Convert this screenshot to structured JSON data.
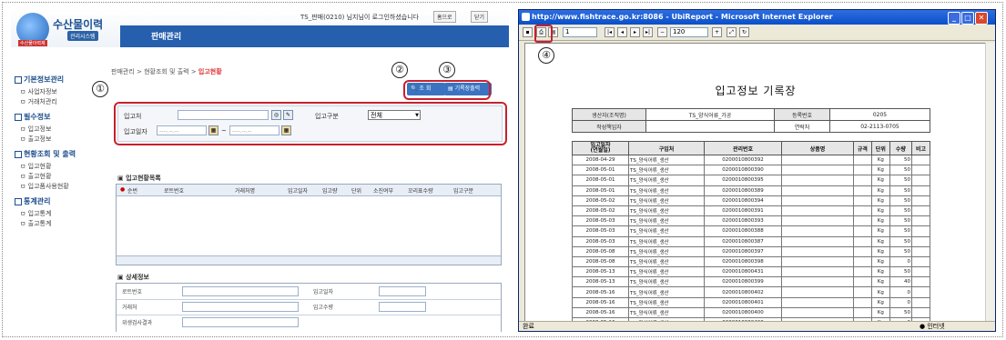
{
  "left": {
    "logo": {
      "title": "수산물이력",
      "subtitle": "관리시스템",
      "tag": "수산물이력제"
    },
    "nav": {
      "item": "판매관리"
    },
    "user_message": "TS_판매(0210) 님지님이 로그인하셨습니다",
    "top_buttons": {
      "home": "홈으로",
      "exit": "닫기"
    },
    "sidebar": {
      "groups": [
        {
          "label": "기본정보관리",
          "items": [
            "사업자정보",
            "거래처관리"
          ]
        },
        {
          "label": "필수정보",
          "items": [
            "입고정보",
            "출고정보"
          ]
        },
        {
          "label": "현황조회 및 출력",
          "items": [
            "입고현황",
            "출고현황",
            "입고품사용현황"
          ]
        },
        {
          "label": "통계관리",
          "items": [
            "입고통계",
            "출고통계"
          ]
        }
      ]
    },
    "breadcrumb": {
      "path": "판매관리 > 현황조회 및 출력 > ",
      "current": "입고현황"
    },
    "markers": [
      "①",
      "②",
      "③"
    ],
    "buttons": {
      "search": "조 회",
      "print": "기록장출력"
    },
    "form": {
      "field1": "입고처",
      "field2": "입고구분",
      "field2_value": "전체",
      "field3": "입고일자",
      "date_from": "----.--.--",
      "date_to": "----.--.--",
      "tilde": "~"
    },
    "list_title": "입고현황목록",
    "grid_headers": [
      "순번",
      "로트번호",
      "거래처명",
      "입고일자",
      "입고량",
      "단위",
      "소진여부",
      "꼬리표수량",
      "입고구분"
    ],
    "detail_title": "상세정보",
    "detail_labels": [
      "로트번호",
      "거래처",
      "위생검사결과",
      "입고일자",
      "입고수량"
    ]
  },
  "ie": {
    "title": "http://www.fishtrace.go.kr:8086 - UbiReport - Microsoft Internet Explorer",
    "toolbar": {
      "page": "1",
      "zoom": "120"
    },
    "marker": "④",
    "report_title": "입고정보 기록장",
    "info": {
      "producer_label": "생산자(조직명)",
      "producer": "TS_양식어류_가공",
      "reg_label": "등록번호",
      "reg": "0205",
      "writer_label": "작성책임자",
      "writer": "",
      "contact_label": "연락처",
      "contact": "02-2113-0705"
    },
    "headers": [
      "입고일자\n(연월일)",
      "구입처",
      "관리번호",
      "상품명",
      "규격",
      "단위",
      "수량",
      "비고"
    ],
    "rows": [
      [
        "2008-04-29",
        "TS_양식어류_생산",
        "0200010800392",
        "",
        "",
        "Kg",
        "50",
        ""
      ],
      [
        "2008-05-01",
        "TS_양식어류_생산",
        "0200010800390",
        "",
        "",
        "Kg",
        "50",
        ""
      ],
      [
        "2008-05-01",
        "TS_양식어류_생산",
        "0200010800395",
        "",
        "",
        "Kg",
        "50",
        ""
      ],
      [
        "2008-05-01",
        "TS_양식어류_생산",
        "0200010800389",
        "",
        "",
        "Kg",
        "50",
        ""
      ],
      [
        "2008-05-02",
        "TS_양식어류_생산",
        "0200010800394",
        "",
        "",
        "Kg",
        "50",
        ""
      ],
      [
        "2008-05-02",
        "TS_양식어류_생산",
        "0200010800391",
        "",
        "",
        "Kg",
        "50",
        ""
      ],
      [
        "2008-05-03",
        "TS_양식어류_생산",
        "0200010800393",
        "",
        "",
        "Kg",
        "50",
        ""
      ],
      [
        "2008-05-03",
        "TS_양식어류_생산",
        "0200010800388",
        "",
        "",
        "Kg",
        "50",
        ""
      ],
      [
        "2008-05-03",
        "TS_양식어류_생산",
        "0200010800387",
        "",
        "",
        "Kg",
        "50",
        ""
      ],
      [
        "2008-05-08",
        "TS_양식어류_생산",
        "0200010800397",
        "",
        "",
        "Kg",
        "50",
        ""
      ],
      [
        "2008-05-08",
        "TS_양식어류_생산",
        "0200010800398",
        "",
        "",
        "Kg",
        "0",
        ""
      ],
      [
        "2008-05-13",
        "TS_양식어류_생산",
        "0200010800431",
        "",
        "",
        "Kg",
        "50",
        ""
      ],
      [
        "2008-05-13",
        "TS_양식어류_생산",
        "0200010800399",
        "",
        "",
        "Kg",
        "40",
        ""
      ],
      [
        "2008-05-16",
        "TS_양식어류_생산",
        "0200010800402",
        "",
        "",
        "Kg",
        "0",
        ""
      ],
      [
        "2008-05-16",
        "TS_양식어류_생산",
        "0200010800401",
        "",
        "",
        "Kg",
        "0",
        ""
      ],
      [
        "2008-05-16",
        "TS_양식어류_생산",
        "0200010800400",
        "",
        "",
        "Kg",
        "50",
        ""
      ],
      [
        "2008-05-16",
        "TS_양식어류_생산",
        "0200010800403",
        "",
        "",
        "Kg",
        "0",
        ""
      ],
      [
        "2008-05-16",
        "TS_양식어류_생산",
        "0200010800430",
        "",
        "",
        "Kg",
        "0",
        ""
      ]
    ],
    "status": {
      "left": "완료",
      "right": "인터넷"
    }
  }
}
